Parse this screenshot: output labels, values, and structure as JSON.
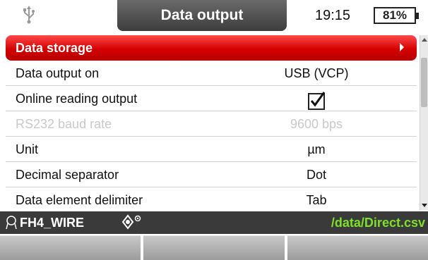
{
  "header": {
    "title": "Data output",
    "time": "19:15",
    "battery": "81%",
    "icons": {
      "connection": "usb-icon"
    }
  },
  "rows": [
    {
      "label": "Data storage",
      "value": "",
      "selected": true
    },
    {
      "label": "Data output on",
      "value": "USB (VCP)"
    },
    {
      "label": "Online reading output",
      "value": "checked",
      "type": "checkbox"
    },
    {
      "label": "RS232 baud rate",
      "value": "9600 bps",
      "disabled": true
    },
    {
      "label": "Unit",
      "value": "µm"
    },
    {
      "label": "Decimal separator",
      "value": "Dot"
    },
    {
      "label": "Data element delimiter",
      "value": "Tab"
    }
  ],
  "status": {
    "probe": "FH4_WIRE",
    "file": "/data/Direct.csv",
    "icons": [
      "probe-icon",
      "measure-mode-icon"
    ]
  },
  "softkeys": [
    "",
    "",
    ""
  ],
  "colors": {
    "selected": "#e00000",
    "status_bg": "#3a3a3a",
    "file_path": "#7ee02a"
  }
}
